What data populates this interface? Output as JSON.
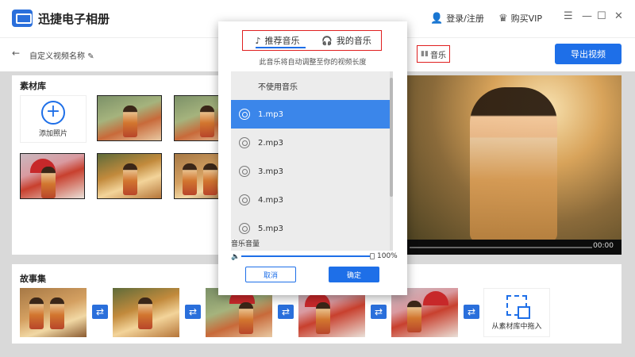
{
  "app": {
    "name": "迅捷电子相册"
  },
  "titlebar": {
    "login": "登录/注册",
    "vip": "购买VIP"
  },
  "nav": {
    "video_name": "自定义视频名称",
    "music_button": "音乐",
    "export_button": "导出视频"
  },
  "library": {
    "title": "素材库",
    "add_label": "添加照片"
  },
  "preview": {
    "time": "00:00"
  },
  "story": {
    "title": "故事集",
    "drag_label": "从素材库中拖入"
  },
  "dialog": {
    "tabs": [
      {
        "label": "推荐音乐",
        "active": true
      },
      {
        "label": "我的音乐",
        "active": false
      }
    ],
    "hint": "此音乐将自动调整至你的视频长度",
    "music_items": [
      {
        "label": "不使用音乐",
        "selected": false
      },
      {
        "label": "1.mp3",
        "selected": true
      },
      {
        "label": "2.mp3",
        "selected": false
      },
      {
        "label": "3.mp3",
        "selected": false
      },
      {
        "label": "4.mp3",
        "selected": false
      },
      {
        "label": "5.mp3",
        "selected": false
      }
    ],
    "volume_label": "音乐音量",
    "volume_percent": "100%",
    "volume_value": 1.0,
    "cancel": "取消",
    "confirm": "确定"
  },
  "colors": {
    "accent": "#1e6fe8",
    "highlight_box": "#e02020",
    "selected_row": "#3b86ea"
  }
}
